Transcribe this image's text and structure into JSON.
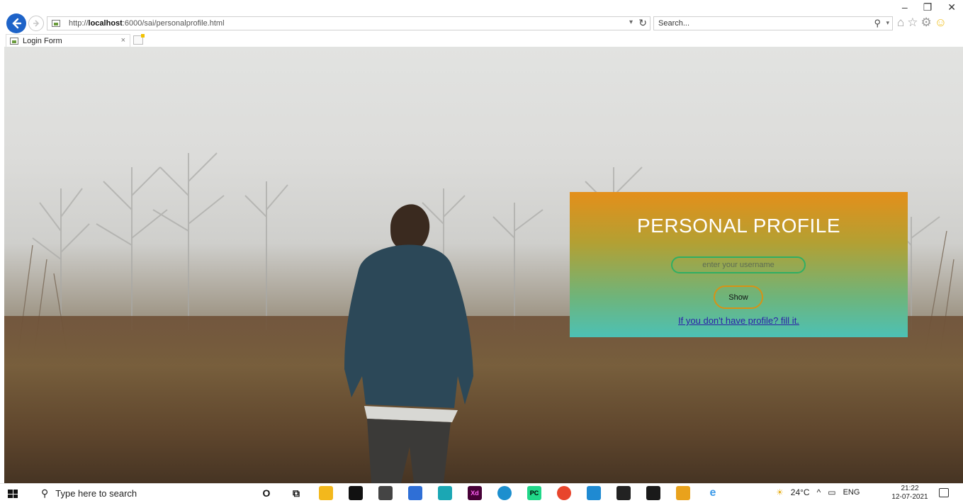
{
  "browser": {
    "url_prefix": "http://",
    "url_host": "localhost",
    "url_path": ":6000/sai/personalprofile.html",
    "search_placeholder": "Search...",
    "tab_title": "Login Form",
    "tab_close": "×",
    "window": {
      "minimize": "–",
      "maximize": "❐",
      "close": "✕"
    }
  },
  "card": {
    "title": "PERSONAL PROFILE",
    "username_placeholder": "enter your username",
    "show_button": "Show",
    "signup_link": "If you don't have profile? fill it.",
    "gradient_top": "#e48f1a",
    "gradient_bottom": "#4cc1b5"
  },
  "taskbar": {
    "search_placeholder": "Type here to search",
    "weather": "24°C",
    "language": "ENG",
    "time": "21:22",
    "date": "12-07-2021",
    "apps": [
      {
        "name": "cortana",
        "glyph": "O",
        "color": "#ffffff"
      },
      {
        "name": "task-view",
        "glyph": "⧉",
        "color": "#ffffff"
      },
      {
        "name": "file-explorer",
        "glyph": "",
        "color": "#f3b81c"
      },
      {
        "name": "store",
        "glyph": "",
        "color": "#111111"
      },
      {
        "name": "mail",
        "glyph": "",
        "color": "#333333"
      },
      {
        "name": "app-blue",
        "glyph": "",
        "color": "#2f6fd6"
      },
      {
        "name": "whatsapp",
        "glyph": "",
        "color": "#1ba7b4"
      },
      {
        "name": "adobe-xd",
        "glyph": "Xd",
        "color": "#470137"
      },
      {
        "name": "edge",
        "glyph": "",
        "color": "#1c8fce"
      },
      {
        "name": "pycharm",
        "glyph": "PC",
        "color": "#21d789"
      },
      {
        "name": "chrome",
        "glyph": "",
        "color": "#e8452c"
      },
      {
        "name": "vscode",
        "glyph": "",
        "color": "#1f8ad2"
      },
      {
        "name": "terminal",
        "glyph": "",
        "color": "#222222"
      },
      {
        "name": "photos",
        "glyph": "",
        "color": "#1a1a1a"
      },
      {
        "name": "paint",
        "glyph": "",
        "color": "#e9a21c"
      },
      {
        "name": "internet-explorer",
        "glyph": "e",
        "color": "#3d9be9"
      }
    ]
  }
}
